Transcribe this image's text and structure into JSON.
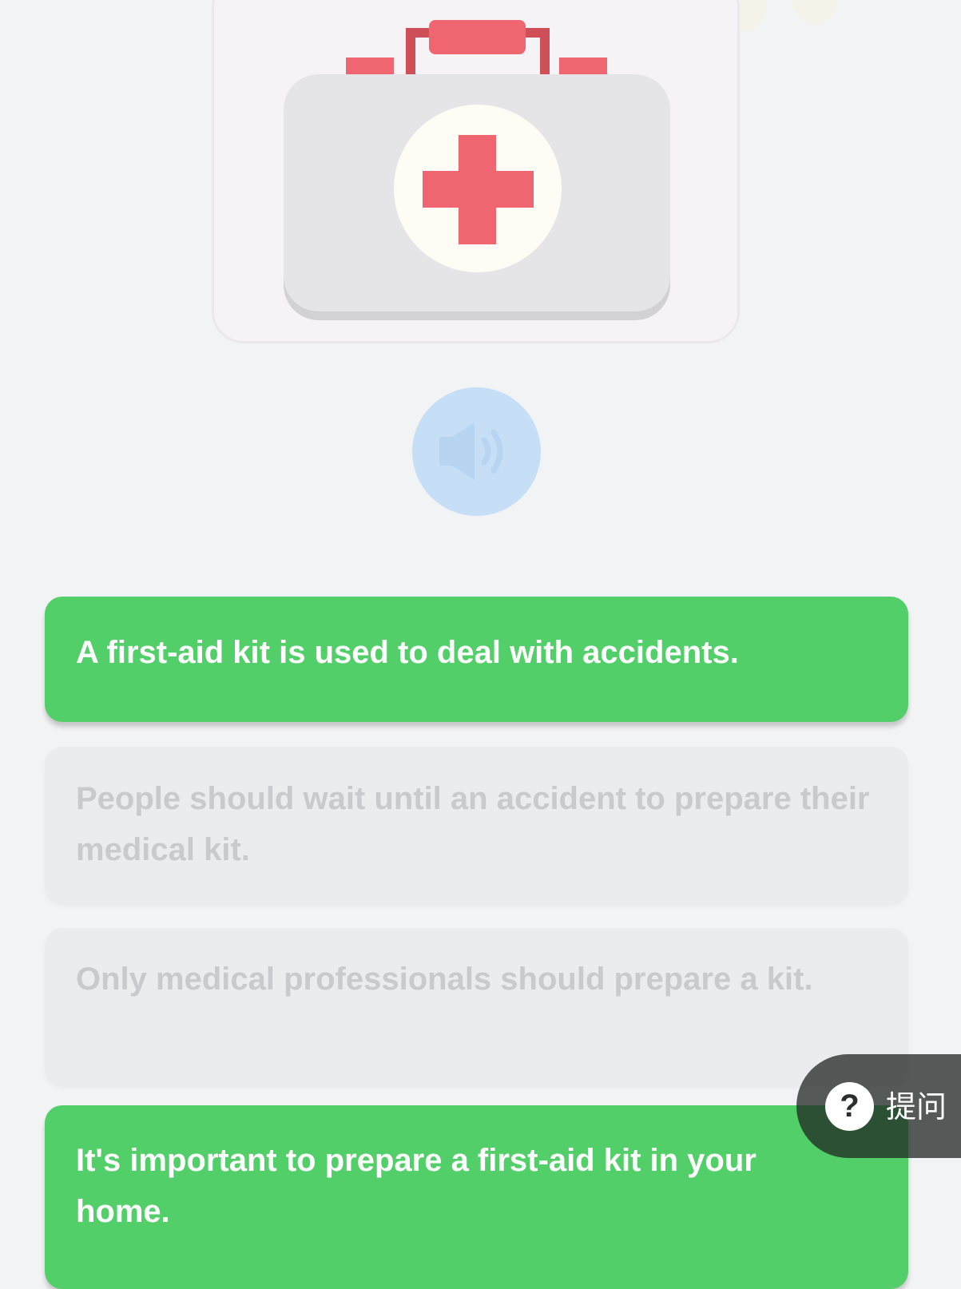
{
  "illustration": {
    "icon": "first-aid-kit-icon",
    "colors": {
      "case": "#e5e5e7",
      "handle": "#ef6670",
      "cross": "#ef6670",
      "circle": "#fffbf5"
    }
  },
  "audio": {
    "icon": "speaker-icon",
    "color": "#c6def6"
  },
  "options": [
    {
      "text": "A first-aid kit is used to deal with accidents.",
      "selected": true
    },
    {
      "text": "People should wait until an accident to prepare their medical kit.",
      "selected": false
    },
    {
      "text": "Only medical professionals should prepare a kit.",
      "selected": false
    },
    {
      "text": "It's important to prepare a first-aid kit in your home.",
      "selected": true
    }
  ],
  "ask_button": {
    "icon": "question-icon",
    "icon_glyph": "?",
    "label": "提问"
  },
  "colors": {
    "selected": "#53cf6a",
    "unselected": "#ebecee",
    "background": "#f2f3f5"
  }
}
